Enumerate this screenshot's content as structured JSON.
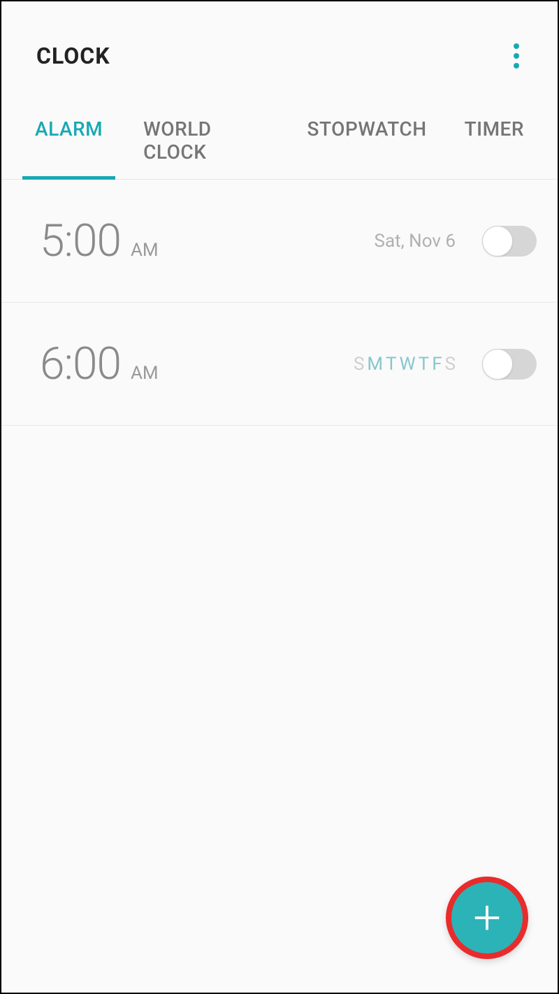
{
  "header": {
    "title": "CLOCK"
  },
  "tabs": [
    {
      "label": "ALARM",
      "active": true
    },
    {
      "label": "WORLD CLOCK",
      "active": false
    },
    {
      "label": "STOPWATCH",
      "active": false
    },
    {
      "label": "TIMER",
      "active": false
    }
  ],
  "alarms": [
    {
      "time": "5:00",
      "ampm": "AM",
      "schedule_type": "date",
      "date_label": "Sat, Nov 6",
      "enabled": false
    },
    {
      "time": "6:00",
      "ampm": "AM",
      "schedule_type": "days",
      "days": [
        {
          "letter": "S",
          "on": false
        },
        {
          "letter": "M",
          "on": true
        },
        {
          "letter": "T",
          "on": true
        },
        {
          "letter": "W",
          "on": true
        },
        {
          "letter": "T",
          "on": true
        },
        {
          "letter": "F",
          "on": true
        },
        {
          "letter": "S",
          "on": false
        }
      ],
      "enabled": false
    }
  ],
  "accent_color": "#18a9b3",
  "fab_color": "#2cb3b7",
  "fab_highlight_ring": "#e82c2c"
}
